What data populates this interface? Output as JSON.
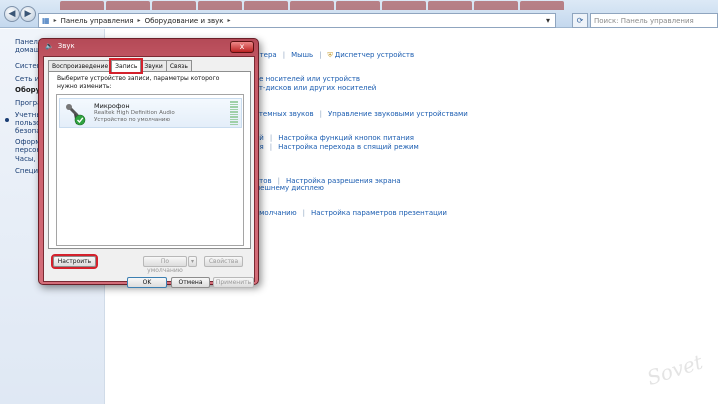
{
  "address": {
    "crumbs": [
      "Панель управления",
      "Оборудование и звук"
    ]
  },
  "search": {
    "placeholder": "Поиск: Панель управления"
  },
  "left_pane": {
    "items": [
      "Панель",
      "домашн",
      "Систем",
      "Сеть и И",
      "Оборуд",
      "Програ",
      "Учетны",
      "пользо",
      "безопас",
      "Оформ",
      "персона",
      "Часы, яз",
      "Специа"
    ]
  },
  "main": {
    "rows": [
      [
        "нтера",
        "Мышь",
        "Диспетчер устройств"
      ],
      [
        "ве носителей или устройств"
      ],
      [
        "ст-дисков или других носителей"
      ],
      [
        "стемных звуков",
        "Управление звуковыми устройствами"
      ],
      [
        "ей",
        "Настройка функций кнопок питания"
      ],
      [
        "ия",
        "Настройка перехода в спящий режим"
      ],
      [
        "ментов",
        "Настройка разрешения экрана"
      ],
      [
        "к внешнему дисплею"
      ],
      [
        "умолчанию",
        "Настройка параметров презентации"
      ]
    ]
  },
  "dialog": {
    "title": "Звук",
    "close": "x",
    "tabs": [
      "Воспроизведение",
      "Запись",
      "Звуки",
      "Связь"
    ],
    "active_tab": "Запись",
    "instruction": "Выберите устройство записи, параметры которого нужно изменить:",
    "device": {
      "name": "Микрофон",
      "driver": "Realtek High Definition Audio",
      "status": "Устройство по умолчанию"
    },
    "buttons": {
      "configure": "Настроить",
      "set_default": "По умолчанию",
      "properties": "Свойства",
      "ok": "OK",
      "cancel": "Отмена",
      "apply": "Применить"
    }
  },
  "watermark": "Sovet"
}
